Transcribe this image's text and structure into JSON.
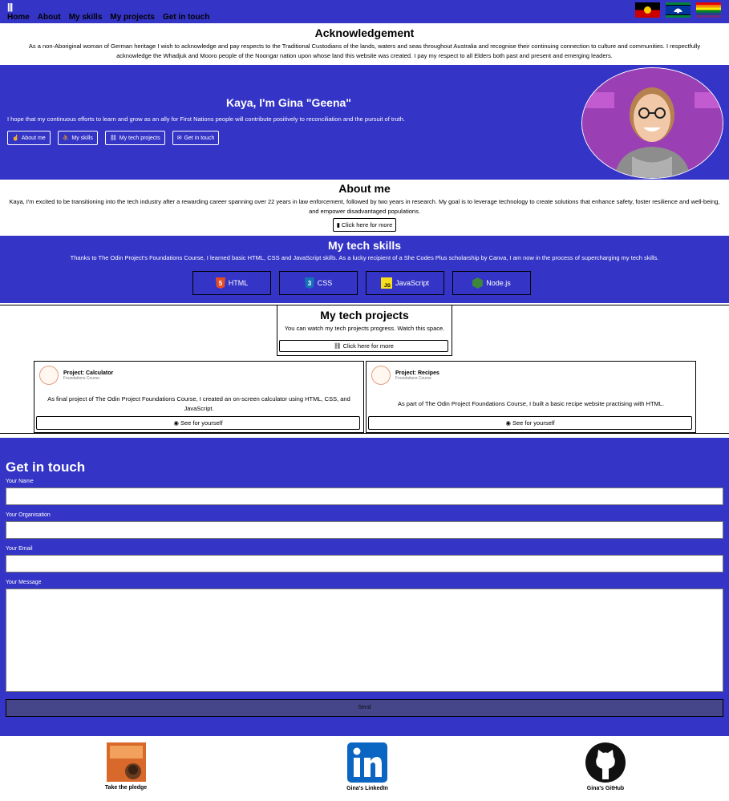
{
  "nav": {
    "menu_icon": "hamburger-icon",
    "links": [
      "Home",
      "About",
      "My skills",
      "My projects",
      "Get in touch"
    ]
  },
  "flags": [
    "aboriginal-flag",
    "torres-strait-islander-flag",
    "rainbow-pride-flag"
  ],
  "acknowledgement": {
    "title": "Acknowledgement",
    "text": "As a non-Aboriginal woman of German heritage I wish to acknowledge and pay respects to the Traditional Custodians of the lands, waters and seas throughout Australia and recognise their continuing connection to culture and communities. I respectfully acknowledge the Whadjuk and Mooro people of the Noongar nation upon whose land this website was created. I pay my respect to all Elders both past and present and emerging leaders."
  },
  "hero": {
    "title": "Kaya, I'm Gina \"Geena\"",
    "tagline": "I hope that my continuous efforts to learn and grow as an ally for First Nations people will contribute positively to reconciliation and the pursuit of truth.",
    "buttons": [
      "About me",
      "My skills",
      "My tech projects",
      "Get in touch"
    ]
  },
  "about": {
    "title": "About me",
    "text": "Kaya, I'm excited to be transitioning into the tech industry after a rewarding career spanning over 22 years in law enforcement, followed by two years in research. My goal is to leverage technology to create solutions that enhance safety, foster resilience and well-being, and empower disadvantaged populations.",
    "button": "Click here for more"
  },
  "skills": {
    "title": "My tech skills",
    "text": "Thanks to The Odin Project's Foundations Course, I learned basic HTML, CSS and JavaScript skills. As a lucky recipient of a She Codes Plus scholarship by Canva, I am now in the process of supercharging my tech skills.",
    "items": [
      {
        "label": "HTML",
        "icon": "html5-icon",
        "color": "#e44d26"
      },
      {
        "label": "CSS",
        "icon": "css3-icon",
        "color": "#1572b6"
      },
      {
        "label": "JavaScript",
        "icon": "javascript-icon",
        "color": "#f7df1e"
      },
      {
        "label": "Node.js",
        "icon": "nodejs-icon",
        "color": "#3c873a"
      }
    ]
  },
  "projects": {
    "title": "My tech projects",
    "text": "You can watch my tech projects progress. Watch this space.",
    "button": "Click here for more",
    "cards": [
      {
        "name": "Project: Calculator",
        "course": "Foundations Course",
        "desc": "As final project of The Odin Project Foundations Course, I created an on-screen calculator using HTML, CSS, and JavaScript.",
        "button": "See for yourself"
      },
      {
        "name": "Project: Recipes",
        "course": "Foundations Course",
        "desc": "As part of The Odin Project Foundations Course, I built a basic recipe website practising with HTML.",
        "button": "See for yourself"
      }
    ]
  },
  "contact": {
    "title": "Get in touch",
    "fields": [
      {
        "label": "Your Name",
        "value": ""
      },
      {
        "label": "Your Organisation",
        "value": ""
      },
      {
        "label": "Your Email",
        "value": ""
      },
      {
        "label": "Your Message",
        "value": ""
      }
    ],
    "send": "Send"
  },
  "footer": {
    "items": [
      "Take the pledge",
      "Gina's LinkedIn",
      "Gina's GitHub"
    ]
  },
  "colors": {
    "brand_blue": "#3434c6",
    "send_button": "#45458a"
  }
}
